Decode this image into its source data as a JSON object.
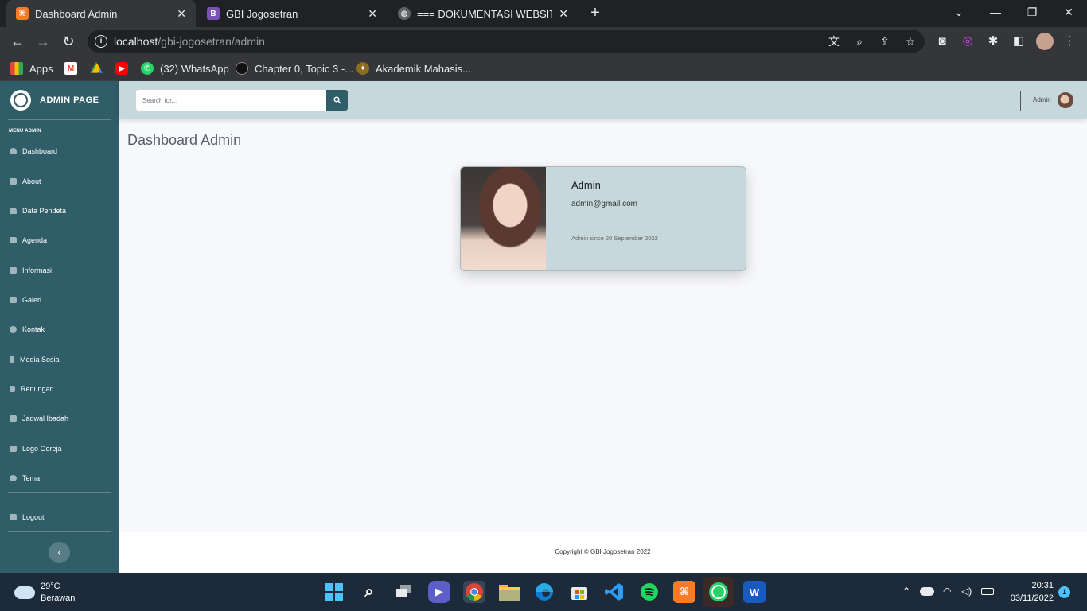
{
  "browser": {
    "tabs": [
      {
        "label": "Dashboard Admin",
        "favicon": "xampp-icon",
        "active": true
      },
      {
        "label": "GBI Jogosetran",
        "favicon": "bootstrap-icon",
        "active": false
      },
      {
        "label": "=== DOKUMENTASI WEBSITE SI",
        "favicon": "globe-icon",
        "active": false
      }
    ],
    "url_host": "localhost",
    "url_path": "/gbi-jogosetran/admin",
    "bookmarks": [
      {
        "label": "Apps",
        "icon": "apps-grid-icon"
      },
      {
        "label": "",
        "icon": "gmail-icon"
      },
      {
        "label": "",
        "icon": "drive-icon"
      },
      {
        "label": "",
        "icon": "youtube-icon"
      },
      {
        "label": "(32) WhatsApp",
        "icon": "whatsapp-icon"
      },
      {
        "label": "Chapter 0, Topic 3 -...",
        "icon": "circle-icon"
      },
      {
        "label": "Akademik Mahasis...",
        "icon": "university-icon"
      }
    ]
  },
  "sidebar": {
    "brand": "ADMIN PAGE",
    "heading": "MENU ADMIN",
    "items": [
      {
        "label": "Dashboard",
        "icon": "tachometer-icon"
      },
      {
        "label": "About",
        "icon": "sitemap-icon"
      },
      {
        "label": "Data Pendeta",
        "icon": "user-icon"
      },
      {
        "label": "Agenda",
        "icon": "copy-icon"
      },
      {
        "label": "Informasi",
        "icon": "list-icon"
      },
      {
        "label": "Galeri",
        "icon": "image-icon"
      },
      {
        "label": "Kontak",
        "icon": "phone-icon"
      },
      {
        "label": "Media Sosial",
        "icon": "mobile-icon"
      },
      {
        "label": "Renungan",
        "icon": "bookmark-icon"
      },
      {
        "label": "Jadwal Ibadah",
        "icon": "calendar-icon"
      },
      {
        "label": "Logo Gereja",
        "icon": "crown-icon"
      },
      {
        "label": "Tema",
        "icon": "palette-icon"
      }
    ],
    "logout": {
      "label": "Logout",
      "icon": "sign-out-icon"
    },
    "toggle_icon": "chevron-left-icon"
  },
  "topbar": {
    "search_placeholder": "Search for...",
    "user_name": "Admin"
  },
  "main": {
    "title": "Dashboard Admin",
    "profile": {
      "name": "Admin",
      "email": "admin@gmail.com",
      "since": "Admin since 20 September 2022"
    }
  },
  "footer": {
    "copyright": "Copyright © GBI Jogosetran 2022"
  },
  "taskbar": {
    "temp": "29°C",
    "weather": "Berawan",
    "time": "20:31",
    "date": "03/11/2022",
    "notifications": "1"
  },
  "colors": {
    "sidebar": "#2f5d68",
    "topbar": "#c6d8db",
    "card": "#c6d8db",
    "page_bg": "#f8f9fc"
  }
}
